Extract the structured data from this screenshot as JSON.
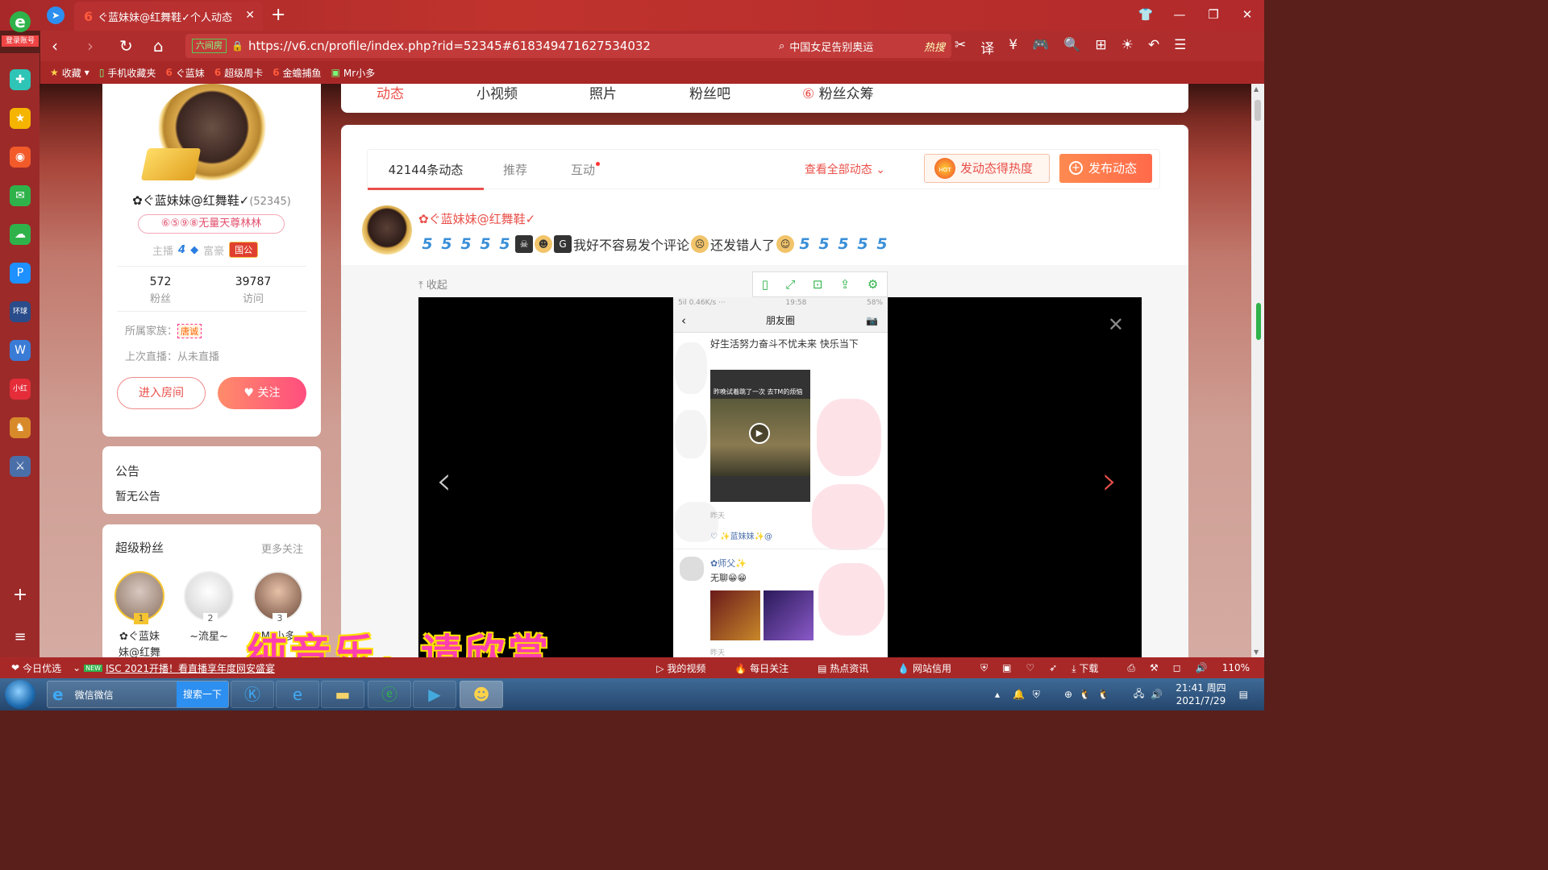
{
  "browser": {
    "login_label": "登录账号",
    "tab_title": "ぐ蓝妹妹@红舞鞋✓个人动态",
    "tab_favicon": "6",
    "url_badge": "六间房",
    "url": "https://v6.cn/profile/index.php?rid=52345#618349471627534032",
    "search_text": "中国女足告别奥运",
    "search_hot": "热搜",
    "bookmarks": [
      "收藏",
      "手机收藏夹",
      "ぐ蓝妹",
      "超级周卡",
      "金蟾捕鱼",
      "Mr小多"
    ]
  },
  "profile": {
    "name": "✿ぐ蓝妹妹@红舞鞋✓",
    "rid": "(52345)",
    "badge": "⑥⑤⑨⑧无量天尊林林",
    "anchor_label": "主播",
    "anchor_level": "4",
    "rich_label": "富豪",
    "rich_tag": "国公",
    "fans_count": "572",
    "fans_label": "粉丝",
    "visits_count": "39787",
    "visits_label": "访问",
    "family_label": "所属家族：",
    "family_value": "唐诚",
    "last_live": "上次直播：从未直播",
    "enter_room": "进入房间",
    "follow": "关注"
  },
  "notice": {
    "title": "公告",
    "body": "暂无公告"
  },
  "super_fans": {
    "title": "超级粉丝",
    "more": "更多关注",
    "fans": [
      {
        "rank": "1",
        "name": "✿ぐ蓝妹",
        "name2": "妹@红舞"
      },
      {
        "rank": "2",
        "name": "~流星~",
        "name2": ""
      },
      {
        "rank": "3",
        "name": "Mr小多",
        "name2": ""
      }
    ]
  },
  "top_tabs": [
    "动态",
    "小视频",
    "照片",
    "粉丝吧",
    "粉丝众筹"
  ],
  "feed": {
    "tabs": [
      "42144条动态",
      "推荐",
      "互动"
    ],
    "view_all": "查看全部动态",
    "hot_btn": "发动态得热度",
    "hot_icon_text": "HOT",
    "post_btn": "发布动态",
    "post": {
      "author": "✿ぐ蓝妹妹@红舞鞋✓",
      "text1": "我好不容易发个评论",
      "text2": "还发错人了"
    },
    "collapse": "收起"
  },
  "phone": {
    "status_left": "5il 0.46K/s ···",
    "status_time": "19:58",
    "status_right": "58%",
    "title": "朋友圈",
    "text1": "好生活努力奋斗不忧未来 快乐当下",
    "video_caption": "昨晚试着跳了一次 去TM的烦恼",
    "meta": "昨天",
    "likes": "♡ ✨蓝妹妹✨@",
    "name2": "✿师父✨",
    "text2": "无聊😁😁",
    "time2": "昨天"
  },
  "subtitle": "纯音乐，请欣赏",
  "statusbar": {
    "left1": "今日优选",
    "news": "ISC 2021开播！看直播享年度网安盛宴",
    "new_tag": "NEW",
    "items": [
      "我的视频",
      "每日关注",
      "热点资讯",
      "网站信用",
      "下载"
    ],
    "zoom": "110%"
  },
  "taskbar": {
    "ie_label": "微信微信",
    "search_btn": "搜索一下",
    "time": "21:41 周四",
    "date": "2021/7/29"
  }
}
